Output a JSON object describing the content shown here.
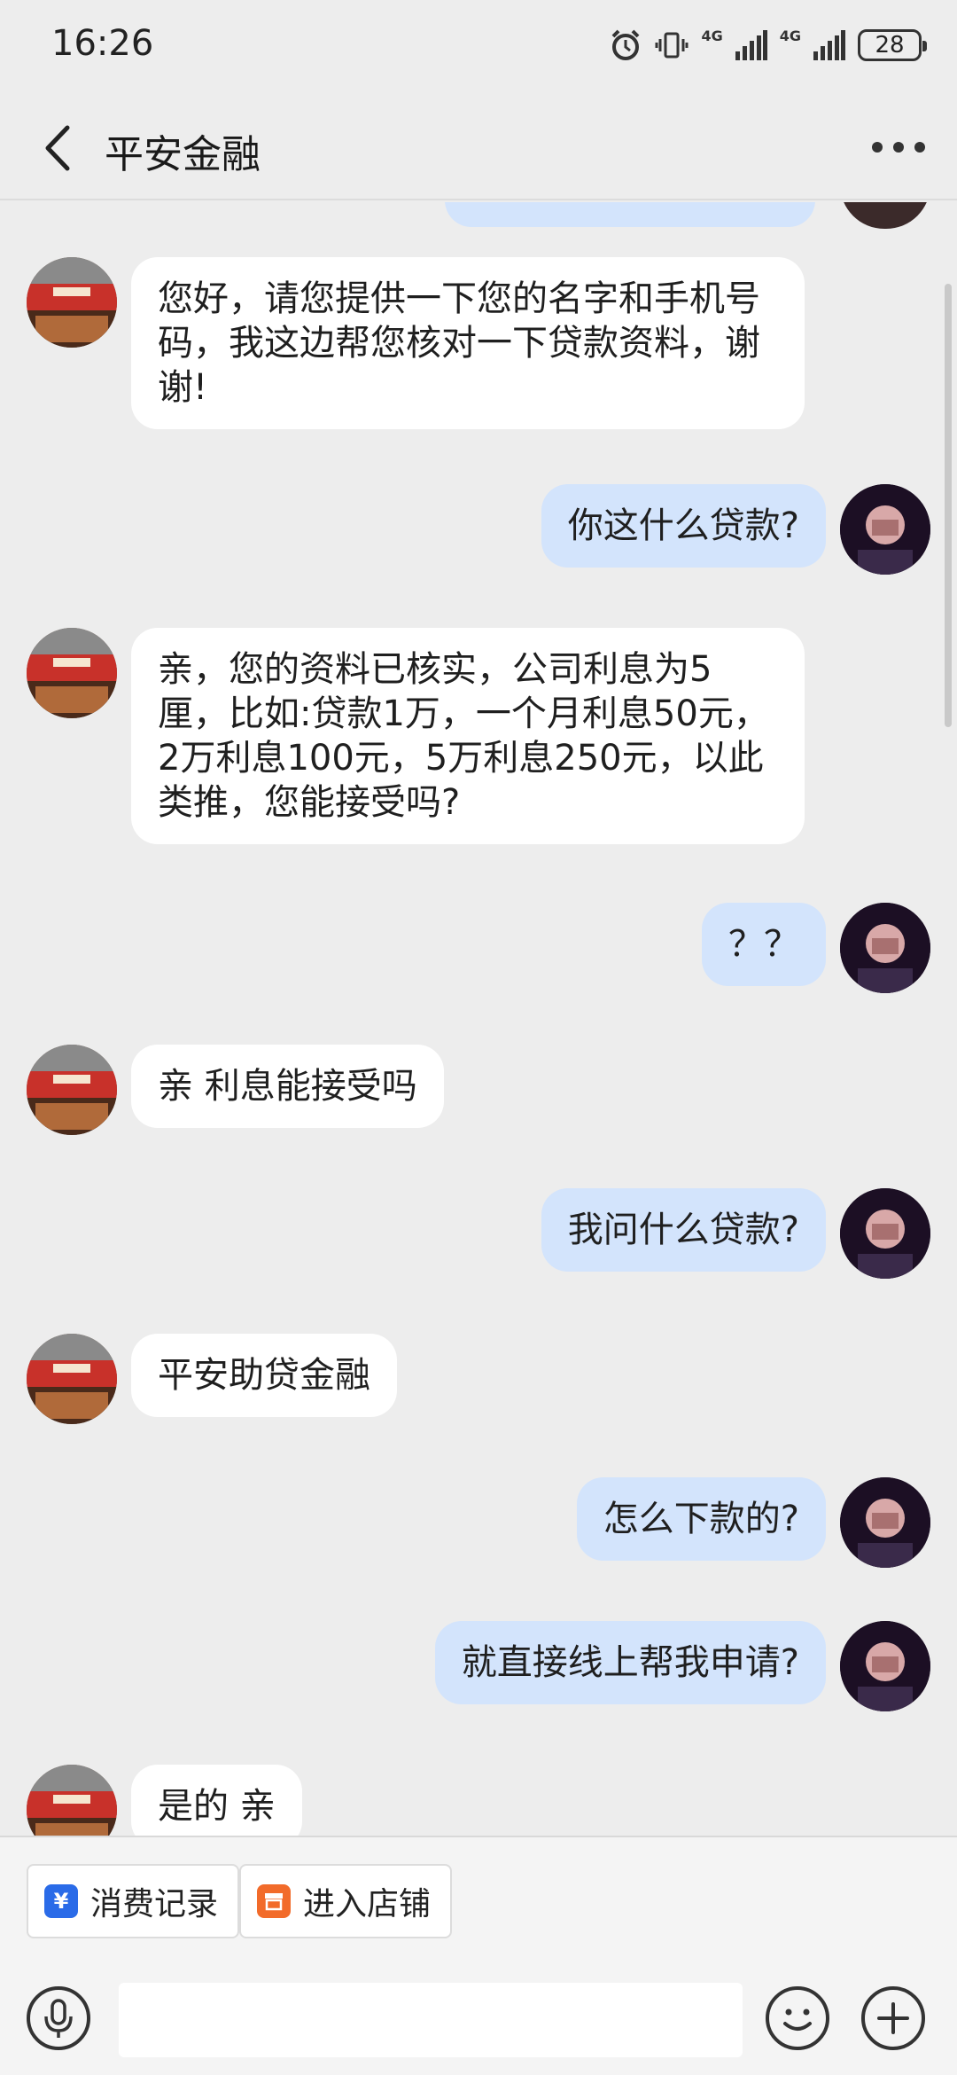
{
  "status_bar": {
    "time": "16:26",
    "network_1": "4G",
    "network_2": "4G",
    "battery": "28"
  },
  "header": {
    "title": "平安金融"
  },
  "messages": [
    {
      "sender": "agent",
      "text": "您好，请您提供一下您的名字和手机号码，我这边帮您核对一下贷款资料，谢谢!"
    },
    {
      "sender": "user",
      "text": "你这什么贷款?"
    },
    {
      "sender": "agent",
      "text": "亲，您的资料已核实，公司利息为5厘，比如:贷款1万，一个月利息50元，2万利息100元，5万利息250元，以此类推，您能接受吗?"
    },
    {
      "sender": "user",
      "text": "？？"
    },
    {
      "sender": "agent",
      "text": "亲 利息能接受吗"
    },
    {
      "sender": "user",
      "text": "我问什么贷款?"
    },
    {
      "sender": "agent",
      "text": "平安助贷金融"
    },
    {
      "sender": "user",
      "text": "怎么下款的?"
    },
    {
      "sender": "user",
      "text": "就直接线上帮我申请?"
    },
    {
      "sender": "agent",
      "text": "是的 亲"
    }
  ],
  "quick_actions": {
    "records_label": "消费记录",
    "store_label": "进入店铺",
    "records_icon": "yen-icon",
    "store_icon": "store-icon",
    "records_color": "#2a6be8",
    "store_color": "#f26b2a"
  },
  "input": {
    "placeholder": ""
  },
  "colors": {
    "background": "#ededed",
    "agent_bubble": "#ffffff",
    "user_bubble": "#d3e4fc"
  }
}
